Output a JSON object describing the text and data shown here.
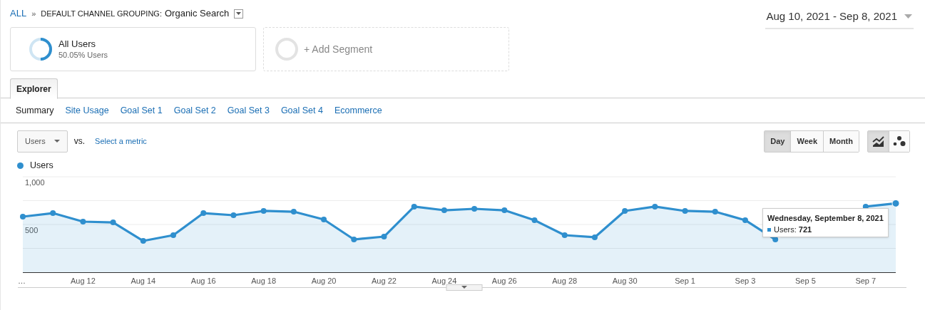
{
  "breadcrumb": {
    "root": "ALL",
    "separator": "»",
    "dimension": "DEFAULT CHANNEL GROUPING:",
    "value": "Organic Search"
  },
  "date_range": "Aug 10, 2021 - Sep 8, 2021",
  "segments": [
    {
      "kind": "segment",
      "title": "All Users",
      "subtitle": "50.05% Users"
    },
    {
      "kind": "add",
      "title": "+ Add Segment"
    }
  ],
  "tabs": [
    {
      "label": "Explorer",
      "selected": true
    }
  ],
  "subtabs": [
    {
      "label": "Summary",
      "selected": true
    },
    {
      "label": "Site Usage",
      "selected": false
    },
    {
      "label": "Goal Set 1",
      "selected": false
    },
    {
      "label": "Goal Set 2",
      "selected": false
    },
    {
      "label": "Goal Set 3",
      "selected": false
    },
    {
      "label": "Goal Set 4",
      "selected": false
    },
    {
      "label": "Ecommerce",
      "selected": false
    }
  ],
  "metric": {
    "value": "Users",
    "vs": "vs.",
    "compare_link": "Select a metric"
  },
  "granularity": [
    {
      "label": "Day",
      "selected": true
    },
    {
      "label": "Week",
      "selected": false
    },
    {
      "label": "Month",
      "selected": false
    }
  ],
  "chart_types": [
    {
      "kind": "line",
      "selected": true
    },
    {
      "kind": "motion",
      "selected": false
    }
  ],
  "chart": {
    "chart_data": {
      "type": "area",
      "series": [
        {
          "name": "Users",
          "color": "#2f8fce",
          "values": [
            582,
            619,
            530,
            522,
            328,
            388,
            619,
            597,
            642,
            634,
            552,
            343,
            373,
            687,
            649,
            664,
            649,
            545,
            388,
            366,
            642,
            687,
            642,
            634,
            545,
            343,
            null,
            null,
            687,
            721
          ]
        }
      ],
      "categories": [
        "…",
        null,
        "Aug 12",
        null,
        "Aug 14",
        null,
        "Aug 16",
        null,
        "Aug 18",
        null,
        "Aug 20",
        null,
        "Aug 22",
        null,
        "Aug 24",
        null,
        "Aug 26",
        null,
        "Aug 28",
        null,
        "Aug 30",
        null,
        "Sep 1",
        null,
        "Sep 3",
        null,
        "Sep 5",
        null,
        "Sep 7",
        null
      ],
      "ylim": [
        0,
        1000
      ],
      "yticks": [
        {
          "value": 500,
          "label": "500"
        },
        {
          "value": 1000,
          "label": "1,000"
        }
      ]
    },
    "tooltip": {
      "title": "Wednesday, September 8, 2021",
      "label": "Users:",
      "value": "721"
    }
  }
}
